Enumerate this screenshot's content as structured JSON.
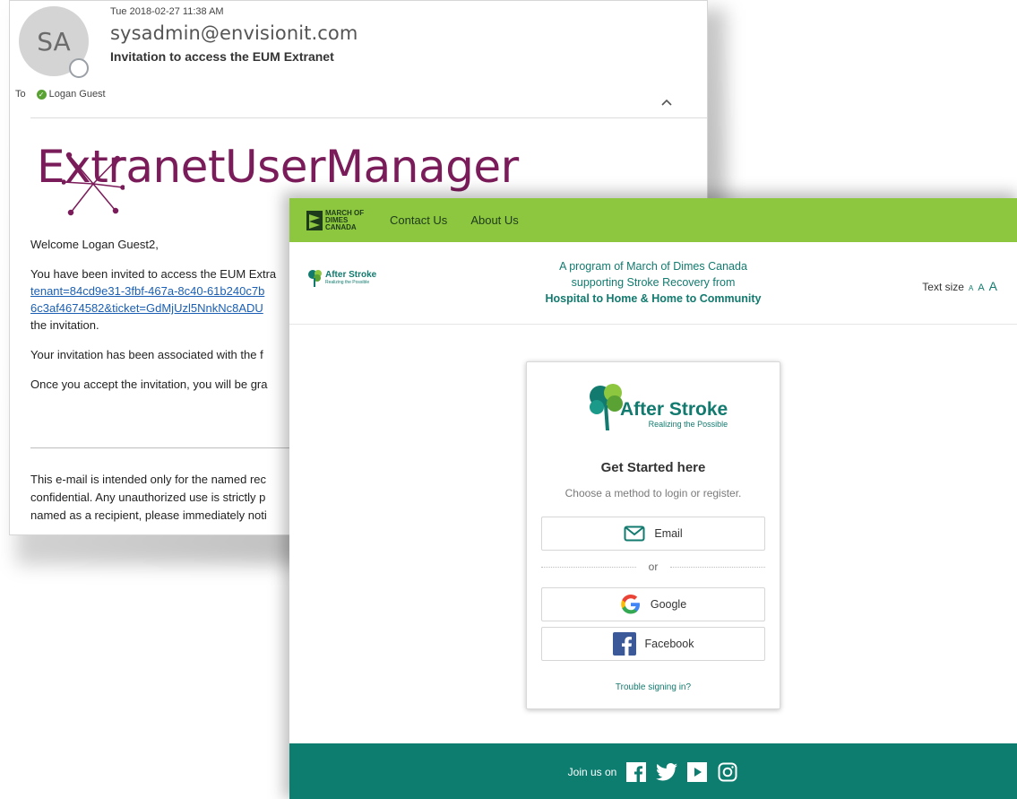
{
  "email": {
    "avatar_initials": "SA",
    "datetime": "Tue 2018-02-27 11:38 AM",
    "from": "sysadmin@envisionit.com",
    "subject": "Invitation to access the EUM Extranet",
    "to_label": "To",
    "to_name": "Logan Guest",
    "logo_prefix": "E",
    "logo_x": "x",
    "logo_rest": "tranetUserManager",
    "greeting": "Welcome Logan Guest2,",
    "invite_text": "You have been invited to access the EUM Extra",
    "link_line1": "tenant=84cd9e31-3fbf-467a-8c40-61b240c7b",
    "link_line2": "6c3af4674582&ticket=GdMjUzl5NnkNc8ADU",
    "invite_tail": "the invitation.",
    "associated_text": "Your invitation has been associated with the f",
    "accept_text": "Once you accept the invitation, you will be gra",
    "disclaimer_1": "This e-mail is intended only for the named rec",
    "disclaimer_2": "confidential. Any unauthorized use is strictly p",
    "disclaimer_3": "named as a recipient, please immediately noti"
  },
  "login": {
    "brand_text": "MARCH OF DIMES CANADA",
    "nav": [
      "Contact Us",
      "About Us"
    ],
    "small_logo_text": "After Stroke",
    "small_logo_sub": "Realizing the Possible",
    "tagline_1": "A program of March of Dimes Canada",
    "tagline_2": "supporting Stroke Recovery from",
    "tagline_3": "Hospital to Home & Home to Community",
    "text_size_label": "Text size",
    "text_size_options": [
      "A",
      "A",
      "A"
    ],
    "card_logo_text": "After Stroke",
    "card_logo_sub": "Realizing the Possible",
    "card_title": "Get Started here",
    "card_subtitle": "Choose a method to login or register.",
    "email_btn": "Email",
    "or_label": "or",
    "google_btn": "Google",
    "facebook_btn": "Facebook",
    "trouble_link": "Trouble signing in?",
    "footer_join": "Join us on",
    "social_icons": [
      "facebook-icon",
      "twitter-icon",
      "youtube-icon",
      "instagram-icon"
    ]
  },
  "colors": {
    "topbar": "#8dc63f",
    "teal": "#127a6e",
    "footer": "#0d7d70",
    "eum_brand": "#7b1c5a",
    "link": "#1a5fb4"
  }
}
